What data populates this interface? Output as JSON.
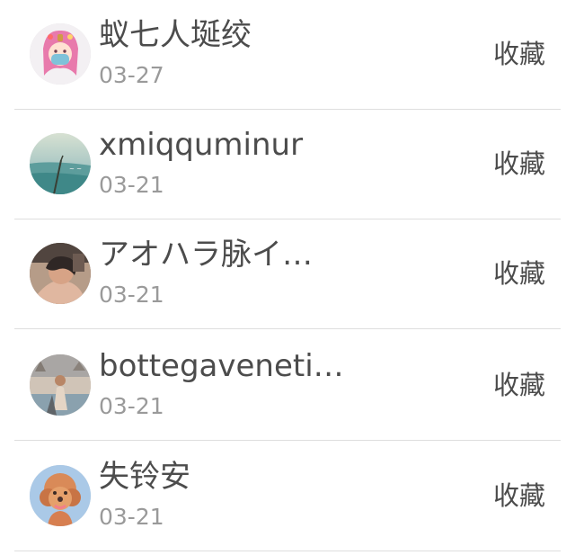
{
  "items": [
    {
      "name": "蚁七人埏绞",
      "date": "03-27",
      "action": "收藏",
      "avatar": "anime-girl-avatar"
    },
    {
      "name": "xmiqquminur",
      "date": "03-21",
      "action": "收藏",
      "avatar": "seaside-landscape-avatar"
    },
    {
      "name": "アオハラ脉イ…",
      "date": "03-21",
      "action": "收藏",
      "avatar": "person-portrait-avatar"
    },
    {
      "name": "bottegaveneti…",
      "date": "03-21",
      "action": "收藏",
      "avatar": "travel-photo-avatar"
    },
    {
      "name": "失铃安",
      "date": "03-21",
      "action": "收藏",
      "avatar": "poodle-dog-avatar"
    }
  ]
}
